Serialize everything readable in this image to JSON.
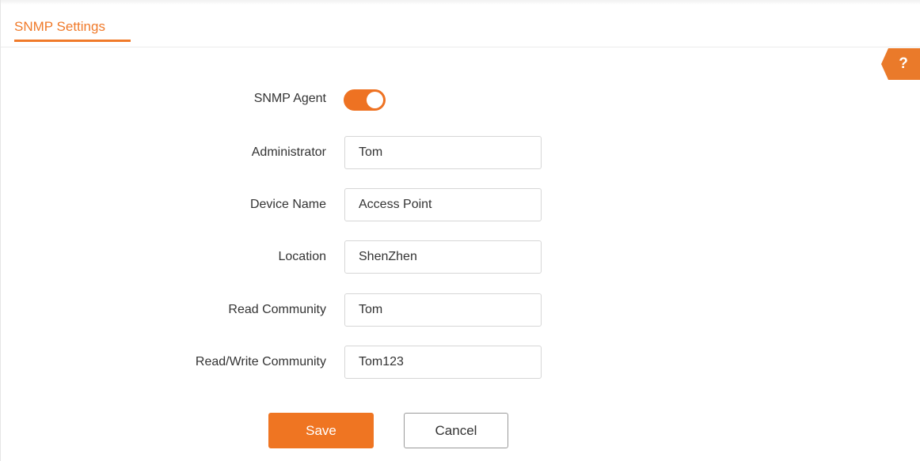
{
  "header": {
    "title": "SNMP Settings"
  },
  "help": {
    "label": "?"
  },
  "form": {
    "snmp_agent": {
      "label": "SNMP Agent",
      "enabled": true
    },
    "administrator": {
      "label": "Administrator",
      "value": "Tom"
    },
    "device_name": {
      "label": "Device Name",
      "value": "Access Point"
    },
    "location": {
      "label": "Location",
      "value": "ShenZhen"
    },
    "read_community": {
      "label": "Read Community",
      "value": "Tom"
    },
    "read_write_community": {
      "label": "Read/Write Community",
      "value": "Tom123"
    }
  },
  "actions": {
    "save_label": "Save",
    "cancel_label": "Cancel"
  },
  "colors": {
    "accent": "#ef7522",
    "text": "#333333",
    "border": "#d6d6d6"
  }
}
